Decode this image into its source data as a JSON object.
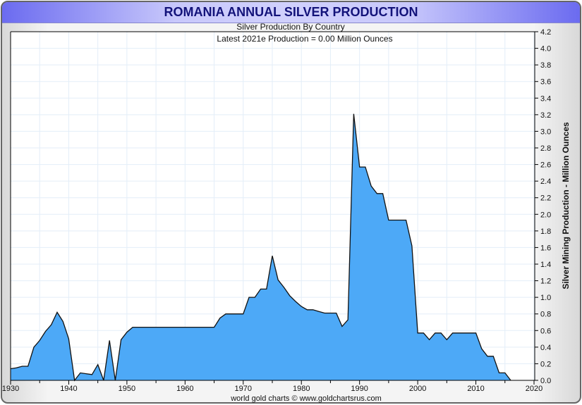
{
  "header": {
    "title": "ROMANIA ANNUAL SILVER PRODUCTION"
  },
  "chart_data": {
    "type": "area",
    "title": "ROMANIA ANNUAL SILVER PRODUCTION",
    "subtitle": "Silver Production By Country",
    "annotation": "Latest 2021e Production = 0.00 Million Ounces",
    "xlabel": "",
    "ylabel": "Silver Mining Production - Million Ounces",
    "xlim": [
      1930,
      2021
    ],
    "ylim": [
      0,
      4.2
    ],
    "x_ticks": [
      "1930",
      "1940",
      "1950",
      "1960",
      "1970",
      "1980",
      "1990",
      "2000",
      "2010",
      "2020"
    ],
    "y_ticks": [
      "0.0",
      "0.2",
      "0.4",
      "0.6",
      "0.8",
      "1.0",
      "1.2",
      "1.4",
      "1.6",
      "1.8",
      "2.0",
      "2.2",
      "2.4",
      "2.6",
      "2.8",
      "3.0",
      "3.2",
      "3.4",
      "3.6",
      "3.8",
      "4.0",
      "4.2"
    ],
    "grid": true,
    "fill_color": "#4da9f7",
    "line_color": "#111111",
    "x": [
      1930,
      1931,
      1932,
      1933,
      1934,
      1935,
      1936,
      1937,
      1938,
      1939,
      1940,
      1941,
      1942,
      1943,
      1944,
      1945,
      1946,
      1947,
      1948,
      1949,
      1950,
      1951,
      1952,
      1953,
      1954,
      1955,
      1956,
      1957,
      1958,
      1959,
      1960,
      1961,
      1962,
      1963,
      1964,
      1965,
      1966,
      1967,
      1968,
      1969,
      1970,
      1971,
      1972,
      1973,
      1974,
      1975,
      1976,
      1977,
      1978,
      1979,
      1980,
      1981,
      1982,
      1983,
      1984,
      1985,
      1986,
      1987,
      1988,
      1989,
      1990,
      1991,
      1992,
      1993,
      1994,
      1995,
      1996,
      1997,
      1998,
      1999,
      2000,
      2001,
      2002,
      2003,
      2004,
      2005,
      2006,
      2007,
      2008,
      2009,
      2010,
      2011,
      2012,
      2013,
      2014,
      2015,
      2016
    ],
    "values": [
      0.14,
      0.15,
      0.17,
      0.17,
      0.4,
      0.48,
      0.59,
      0.67,
      0.82,
      0.71,
      0.5,
      0.0,
      0.09,
      0.08,
      0.07,
      0.19,
      0.0,
      0.48,
      0.0,
      0.49,
      0.58,
      0.64,
      0.64,
      0.64,
      0.64,
      0.64,
      0.64,
      0.64,
      0.64,
      0.64,
      0.64,
      0.64,
      0.64,
      0.64,
      0.64,
      0.64,
      0.75,
      0.8,
      0.8,
      0.8,
      0.8,
      1.0,
      1.0,
      1.1,
      1.1,
      1.5,
      1.21,
      1.12,
      1.02,
      0.95,
      0.89,
      0.85,
      0.85,
      0.83,
      0.81,
      0.81,
      0.81,
      0.65,
      0.73,
      3.21,
      2.57,
      2.57,
      2.34,
      2.25,
      2.25,
      1.93,
      1.93,
      1.93,
      1.93,
      1.62,
      0.57,
      0.57,
      0.49,
      0.57,
      0.57,
      0.49,
      0.57,
      0.57,
      0.57,
      0.57,
      0.57,
      0.38,
      0.29,
      0.29,
      0.09,
      0.09,
      0.0
    ],
    "footer": "world gold charts © www.goldchartsrus.com"
  }
}
